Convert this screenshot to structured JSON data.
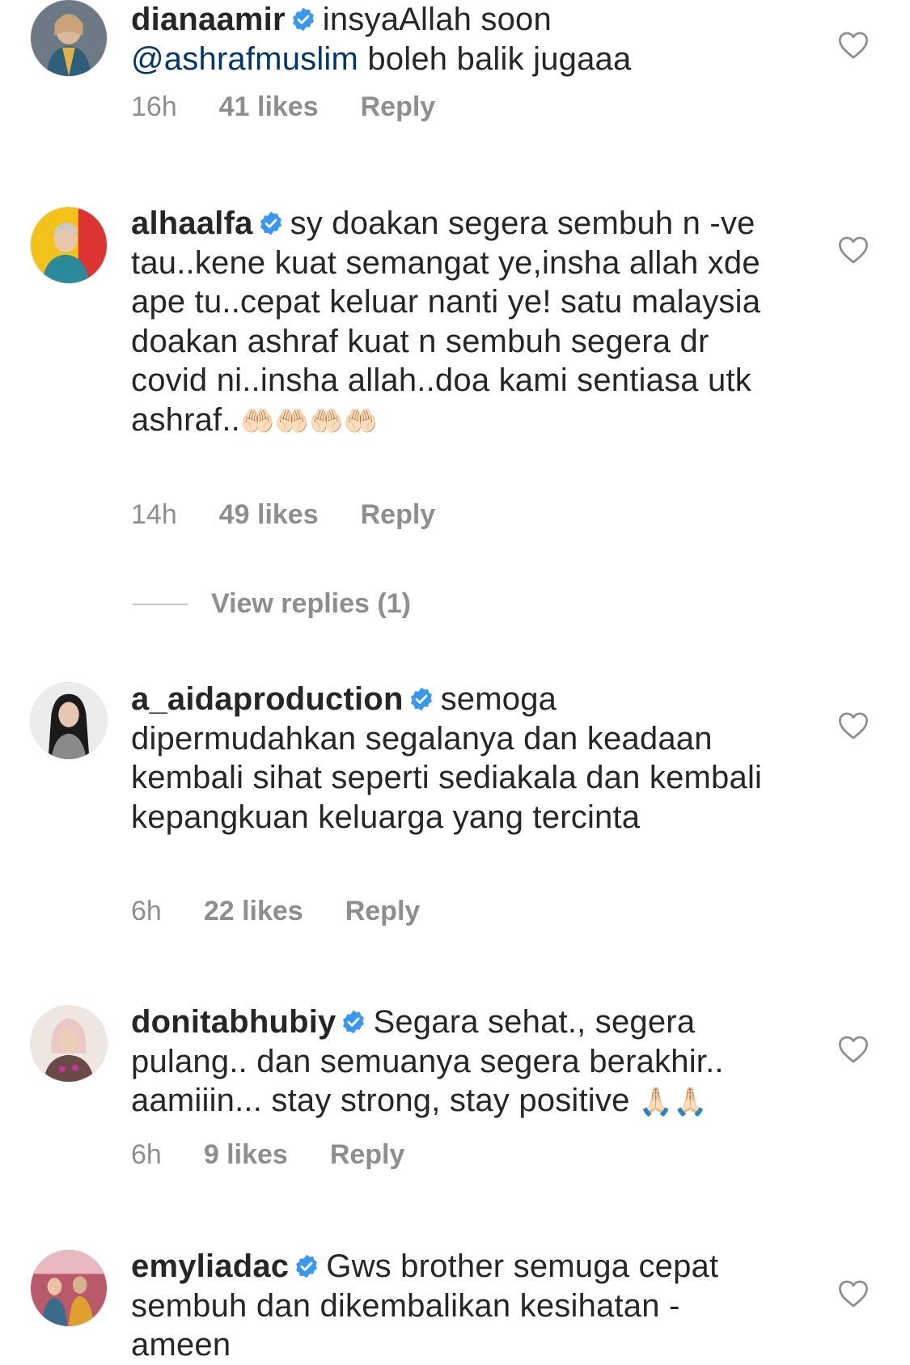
{
  "colors": {
    "text": "#262626",
    "meta": "#8e8e8e",
    "mention": "#00376b",
    "verified": "#3897f0"
  },
  "comments": [
    {
      "username": "dianaamir",
      "verified_icon": "verified-badge-icon",
      "text": "insyaAllah soon",
      "mention": "@ashrafmuslim",
      "text_after": " boleh balik jugaaa",
      "time": "16h",
      "likes": "41 likes",
      "reply": "Reply",
      "heart_icon": "heart-outline-icon"
    },
    {
      "username": "alhaalfa",
      "verified_icon": "verified-badge-icon",
      "text": "sy doakan segera sembuh n -ve tau..kene kuat semangat ye,insha allah xde ape tu..cepat keluar nanti ye! satu malaysia doakan ashraf kuat n sembuh segera dr covid ni..insha allah..doa kami sentiasa utk ashraf..",
      "emojis": "🤲🏻🤲🏻🤲🏻🤲🏻",
      "time": "14h",
      "likes": "49 likes",
      "reply": "Reply",
      "heart_icon": "heart-outline-icon",
      "view_replies": "View replies (1)"
    },
    {
      "username": "a_aidaproduction",
      "verified_icon": "verified-badge-icon",
      "text": "semoga dipermudahkan segalanya dan keadaan kembali sihat seperti sediakala dan kembali kepangkuan keluarga yang tercinta",
      "time": "6h",
      "likes": "22 likes",
      "reply": "Reply",
      "heart_icon": "heart-outline-icon"
    },
    {
      "username": "donitabhubiy",
      "verified_icon": "verified-badge-icon",
      "text": "Segara sehat., segera pulang.. dan semuanya segera berakhir.. aamiiin... stay strong, stay positive",
      "emojis": "🙏🏻🙏🏻",
      "time": "6h",
      "likes": "9 likes",
      "reply": "Reply",
      "heart_icon": "heart-outline-icon"
    },
    {
      "username": "emyliadac",
      "verified_icon": "verified-badge-icon",
      "text": "Gws brother semuga cepat sembuh dan dikembalikan  kesihatan -ameen",
      "heart_icon": "heart-outline-icon"
    }
  ]
}
